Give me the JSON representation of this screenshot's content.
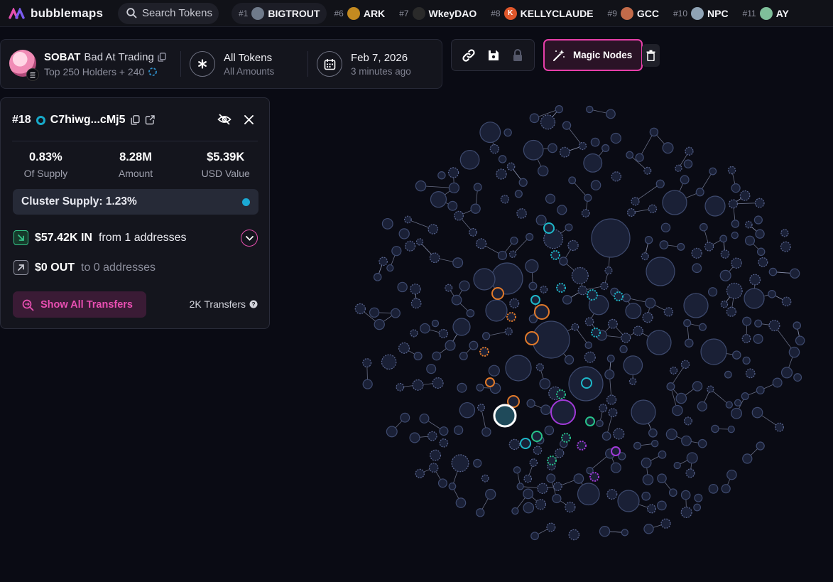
{
  "app": {
    "name": "bubblemaps"
  },
  "search": {
    "label": "Search Tokens"
  },
  "ticker": [
    {
      "rank": "#1",
      "name": "BIGTROUT",
      "active": true,
      "icon": "trout-icon",
      "color": "#6f7a8a"
    },
    {
      "rank": "#6",
      "name": "ARK",
      "active": false,
      "icon": "ark-icon",
      "color": "#c48a20"
    },
    {
      "rank": "#7",
      "name": "WkeyDAO",
      "active": false,
      "icon": "wkey-icon",
      "color": "#2a2a2a"
    },
    {
      "rank": "#8",
      "name": "KELLYCLAUDE",
      "active": false,
      "icon": "kelly-icon",
      "color": "#e0572b",
      "letter": "K"
    },
    {
      "rank": "#9",
      "name": "GCC",
      "active": false,
      "icon": "gcc-icon",
      "color": "#c36b4a"
    },
    {
      "rank": "#10",
      "name": "NPC",
      "active": false,
      "icon": "npc-icon",
      "color": "#8fa3b5"
    },
    {
      "rank": "#11",
      "name": "AY",
      "active": false,
      "icon": "ay-icon",
      "color": "#7fbf9a"
    }
  ],
  "token": {
    "symbol": "SOBAT",
    "full_name": "Bad At Trading",
    "holders": "Top 250 Holders + 240"
  },
  "filter": {
    "title": "All Tokens",
    "subtitle": "All Amounts"
  },
  "date": {
    "title": "Feb 7, 2026",
    "subtitle": "3 minutes ago"
  },
  "magic": {
    "label": "Magic Nodes"
  },
  "panel": {
    "rank": "#18",
    "address": "C7hiwg...cMj5",
    "stats": [
      {
        "value": "0.83%",
        "label": "Of Supply"
      },
      {
        "value": "8.28M",
        "label": "Amount"
      },
      {
        "value": "$5.39K",
        "label": "USD Value"
      }
    ],
    "cluster": "Cluster Supply: 1.23%",
    "in": {
      "amount": "$57.42K IN",
      "desc": "from 1 addresses"
    },
    "out": {
      "amount": "$0 OUT",
      "desc": "to 0 addresses"
    },
    "show_button": "Show All Transfers",
    "transfers": "2K Transfers"
  },
  "colors": {
    "accent": "#e63fa9",
    "bubble_fill": "#1a2036",
    "bubble_stroke": "#3e4a6e",
    "orange": "#e27a2a",
    "teal": "#1eb7c9",
    "green": "#27c28a",
    "purple": "#a23ad9"
  }
}
